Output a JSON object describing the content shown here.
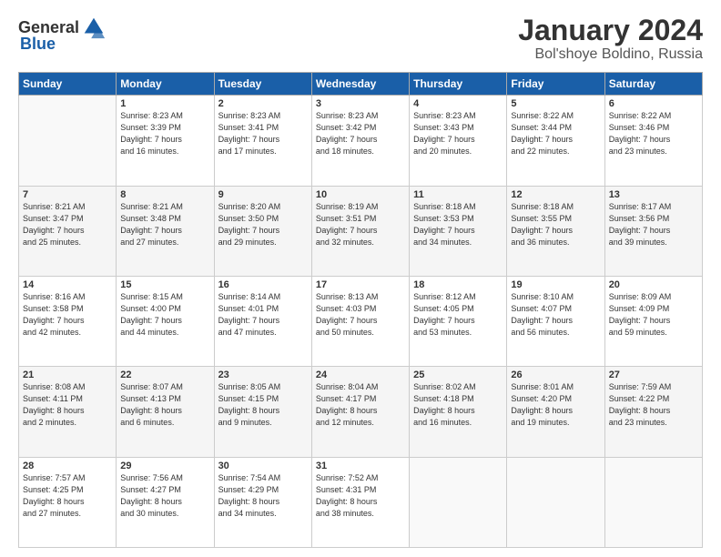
{
  "logo": {
    "general": "General",
    "blue": "Blue"
  },
  "title": "January 2024",
  "subtitle": "Bol'shoye Boldino, Russia",
  "weekdays": [
    "Sunday",
    "Monday",
    "Tuesday",
    "Wednesday",
    "Thursday",
    "Friday",
    "Saturday"
  ],
  "weeks": [
    [
      {
        "day": null,
        "data": null
      },
      {
        "day": "1",
        "data": "Sunrise: 8:23 AM\nSunset: 3:39 PM\nDaylight: 7 hours\nand 16 minutes."
      },
      {
        "day": "2",
        "data": "Sunrise: 8:23 AM\nSunset: 3:41 PM\nDaylight: 7 hours\nand 17 minutes."
      },
      {
        "day": "3",
        "data": "Sunrise: 8:23 AM\nSunset: 3:42 PM\nDaylight: 7 hours\nand 18 minutes."
      },
      {
        "day": "4",
        "data": "Sunrise: 8:23 AM\nSunset: 3:43 PM\nDaylight: 7 hours\nand 20 minutes."
      },
      {
        "day": "5",
        "data": "Sunrise: 8:22 AM\nSunset: 3:44 PM\nDaylight: 7 hours\nand 22 minutes."
      },
      {
        "day": "6",
        "data": "Sunrise: 8:22 AM\nSunset: 3:46 PM\nDaylight: 7 hours\nand 23 minutes."
      }
    ],
    [
      {
        "day": "7",
        "data": "Sunrise: 8:21 AM\nSunset: 3:47 PM\nDaylight: 7 hours\nand 25 minutes."
      },
      {
        "day": "8",
        "data": "Sunrise: 8:21 AM\nSunset: 3:48 PM\nDaylight: 7 hours\nand 27 minutes."
      },
      {
        "day": "9",
        "data": "Sunrise: 8:20 AM\nSunset: 3:50 PM\nDaylight: 7 hours\nand 29 minutes."
      },
      {
        "day": "10",
        "data": "Sunrise: 8:19 AM\nSunset: 3:51 PM\nDaylight: 7 hours\nand 32 minutes."
      },
      {
        "day": "11",
        "data": "Sunrise: 8:18 AM\nSunset: 3:53 PM\nDaylight: 7 hours\nand 34 minutes."
      },
      {
        "day": "12",
        "data": "Sunrise: 8:18 AM\nSunset: 3:55 PM\nDaylight: 7 hours\nand 36 minutes."
      },
      {
        "day": "13",
        "data": "Sunrise: 8:17 AM\nSunset: 3:56 PM\nDaylight: 7 hours\nand 39 minutes."
      }
    ],
    [
      {
        "day": "14",
        "data": "Sunrise: 8:16 AM\nSunset: 3:58 PM\nDaylight: 7 hours\nand 42 minutes."
      },
      {
        "day": "15",
        "data": "Sunrise: 8:15 AM\nSunset: 4:00 PM\nDaylight: 7 hours\nand 44 minutes."
      },
      {
        "day": "16",
        "data": "Sunrise: 8:14 AM\nSunset: 4:01 PM\nDaylight: 7 hours\nand 47 minutes."
      },
      {
        "day": "17",
        "data": "Sunrise: 8:13 AM\nSunset: 4:03 PM\nDaylight: 7 hours\nand 50 minutes."
      },
      {
        "day": "18",
        "data": "Sunrise: 8:12 AM\nSunset: 4:05 PM\nDaylight: 7 hours\nand 53 minutes."
      },
      {
        "day": "19",
        "data": "Sunrise: 8:10 AM\nSunset: 4:07 PM\nDaylight: 7 hours\nand 56 minutes."
      },
      {
        "day": "20",
        "data": "Sunrise: 8:09 AM\nSunset: 4:09 PM\nDaylight: 7 hours\nand 59 minutes."
      }
    ],
    [
      {
        "day": "21",
        "data": "Sunrise: 8:08 AM\nSunset: 4:11 PM\nDaylight: 8 hours\nand 2 minutes."
      },
      {
        "day": "22",
        "data": "Sunrise: 8:07 AM\nSunset: 4:13 PM\nDaylight: 8 hours\nand 6 minutes."
      },
      {
        "day": "23",
        "data": "Sunrise: 8:05 AM\nSunset: 4:15 PM\nDaylight: 8 hours\nand 9 minutes."
      },
      {
        "day": "24",
        "data": "Sunrise: 8:04 AM\nSunset: 4:17 PM\nDaylight: 8 hours\nand 12 minutes."
      },
      {
        "day": "25",
        "data": "Sunrise: 8:02 AM\nSunset: 4:18 PM\nDaylight: 8 hours\nand 16 minutes."
      },
      {
        "day": "26",
        "data": "Sunrise: 8:01 AM\nSunset: 4:20 PM\nDaylight: 8 hours\nand 19 minutes."
      },
      {
        "day": "27",
        "data": "Sunrise: 7:59 AM\nSunset: 4:22 PM\nDaylight: 8 hours\nand 23 minutes."
      }
    ],
    [
      {
        "day": "28",
        "data": "Sunrise: 7:57 AM\nSunset: 4:25 PM\nDaylight: 8 hours\nand 27 minutes."
      },
      {
        "day": "29",
        "data": "Sunrise: 7:56 AM\nSunset: 4:27 PM\nDaylight: 8 hours\nand 30 minutes."
      },
      {
        "day": "30",
        "data": "Sunrise: 7:54 AM\nSunset: 4:29 PM\nDaylight: 8 hours\nand 34 minutes."
      },
      {
        "day": "31",
        "data": "Sunrise: 7:52 AM\nSunset: 4:31 PM\nDaylight: 8 hours\nand 38 minutes."
      },
      {
        "day": null,
        "data": null
      },
      {
        "day": null,
        "data": null
      },
      {
        "day": null,
        "data": null
      }
    ]
  ]
}
